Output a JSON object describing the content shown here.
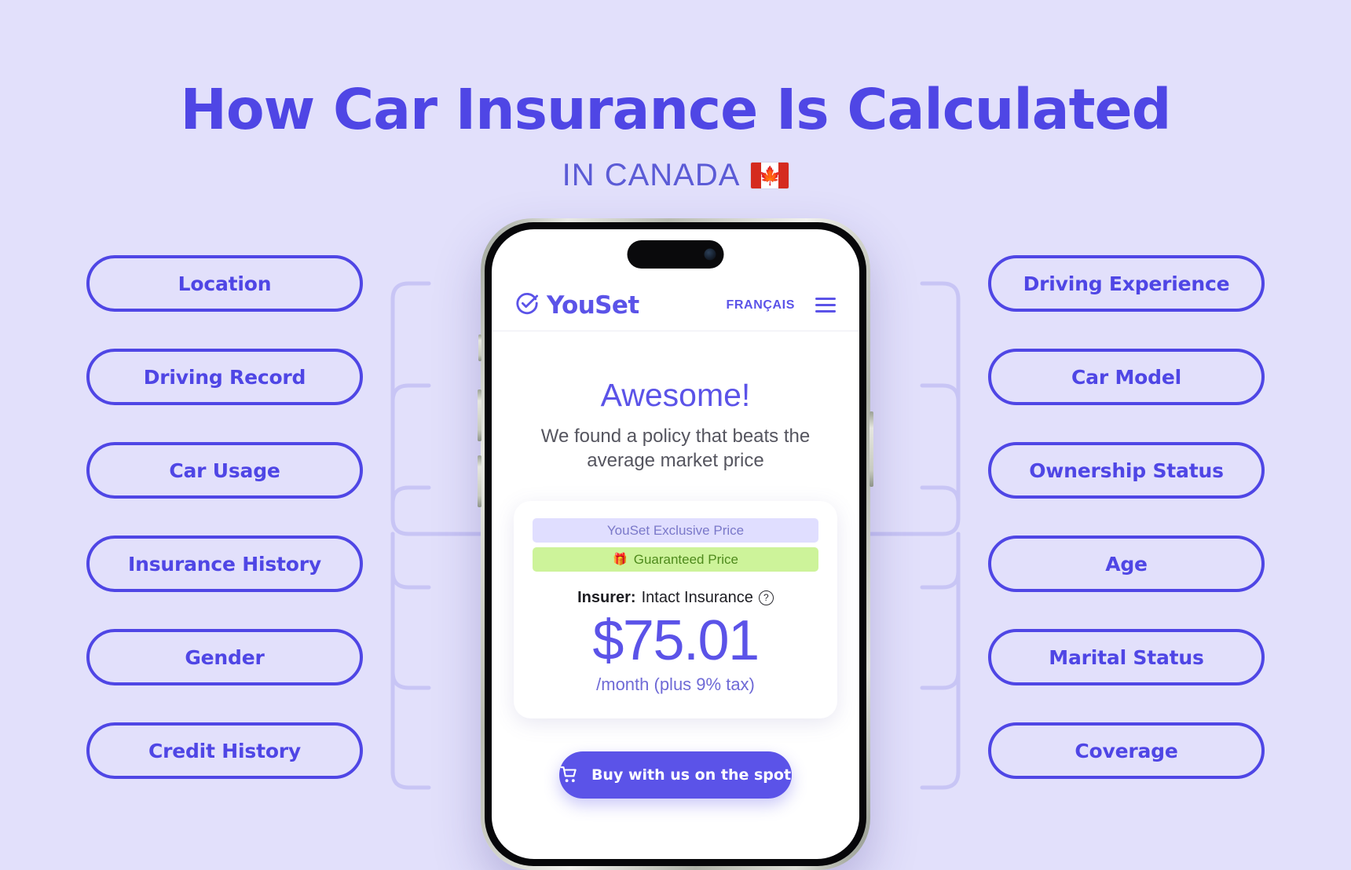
{
  "header": {
    "title": "How Car Insurance Is Calculated",
    "subtitle": "IN CANADA",
    "flag": "canada-flag",
    "flag_leaf": "☘"
  },
  "colors": {
    "background": "#e2e0fb",
    "accent": "#4f46e5",
    "brand_purple": "#5b53e8",
    "connector": "#c8c5f5",
    "ribbon_exclusive_bg": "#e0deff",
    "ribbon_guaranteed_bg": "#cdf39a",
    "guaranteed_text": "#4e8a1c"
  },
  "factors": {
    "left": [
      {
        "label": "Location"
      },
      {
        "label": "Driving Record"
      },
      {
        "label": "Car Usage"
      },
      {
        "label": "Insurance History"
      },
      {
        "label": "Gender"
      },
      {
        "label": "Credit History"
      }
    ],
    "right": [
      {
        "label": "Driving Experience"
      },
      {
        "label": "Car Model"
      },
      {
        "label": "Ownership Status"
      },
      {
        "label": "Age"
      },
      {
        "label": "Marital Status"
      },
      {
        "label": "Coverage"
      }
    ]
  },
  "phone": {
    "app": {
      "nav": {
        "brand": "YouSet",
        "logo_icon": "check-circle-icon",
        "language_link": "FRANÇAIS",
        "menu_icon": "hamburger-menu-icon"
      },
      "result": {
        "headline": "Awesome!",
        "subhead": "We found a policy that beats the average market price"
      },
      "price_card": {
        "exclusive_ribbon": "YouSet Exclusive Price",
        "guaranteed_ribbon": "Guaranteed Price",
        "gift_icon": "🎁",
        "insurer_label": "Insurer:",
        "insurer_name": "Intact Insurance",
        "help_icon": "?",
        "price": "$75.01",
        "price_note": "/month (plus 9% tax)"
      },
      "cta": {
        "label": "Buy with us on the spot",
        "icon": "shopping-cart-icon"
      }
    }
  }
}
